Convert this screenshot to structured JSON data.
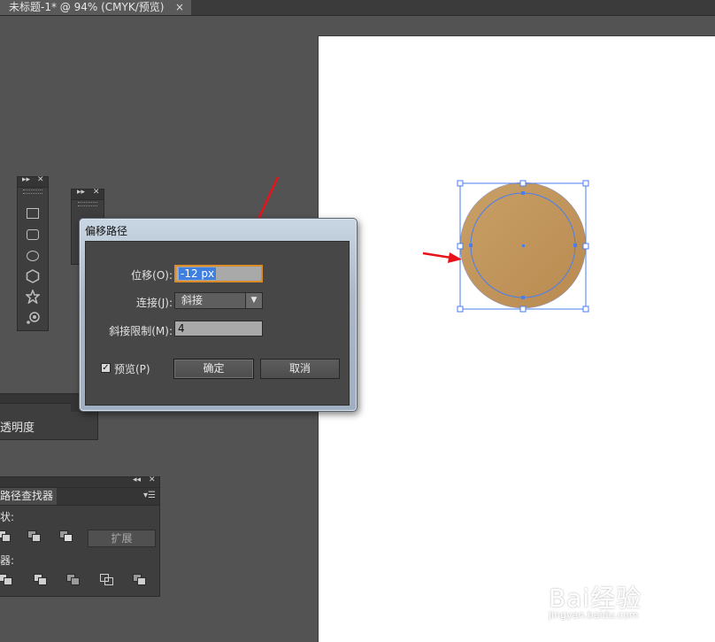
{
  "document_tab": {
    "title": "未标题-1* @ 94% (CMYK/预览)",
    "close_glyph": "×"
  },
  "panels": {
    "tools_panel_a_icons": [
      "rectangle-icon",
      "rounded-rectangle-icon",
      "ellipse-icon",
      "polygon-icon",
      "star-icon",
      "flare-icon"
    ],
    "transparency_label": "透明度",
    "pathfinder": {
      "tab": "路径查找器",
      "shape_modes_label": "状:",
      "pathfinders_label": "器:",
      "expand_button": "扩展"
    }
  },
  "dialog": {
    "title": "偏移路径",
    "offset_label": "位移(O):",
    "offset_value": "-12 px",
    "joins_label": "连接(J):",
    "joins_value": "斜接",
    "miter_label": "斜接限制(M):",
    "miter_value": "4",
    "preview_label": "预览(P)",
    "preview_checked": true,
    "ok_label": "确定",
    "cancel_label": "取消"
  },
  "artwork": {
    "fill_light": "#c8a067",
    "fill_dark": "#b98a50",
    "selection_color": "#4a7ef0"
  },
  "annotation_color": "#e8121a",
  "watermark": {
    "brand": "Bai经验",
    "url": "jingyan.baidu.com"
  }
}
